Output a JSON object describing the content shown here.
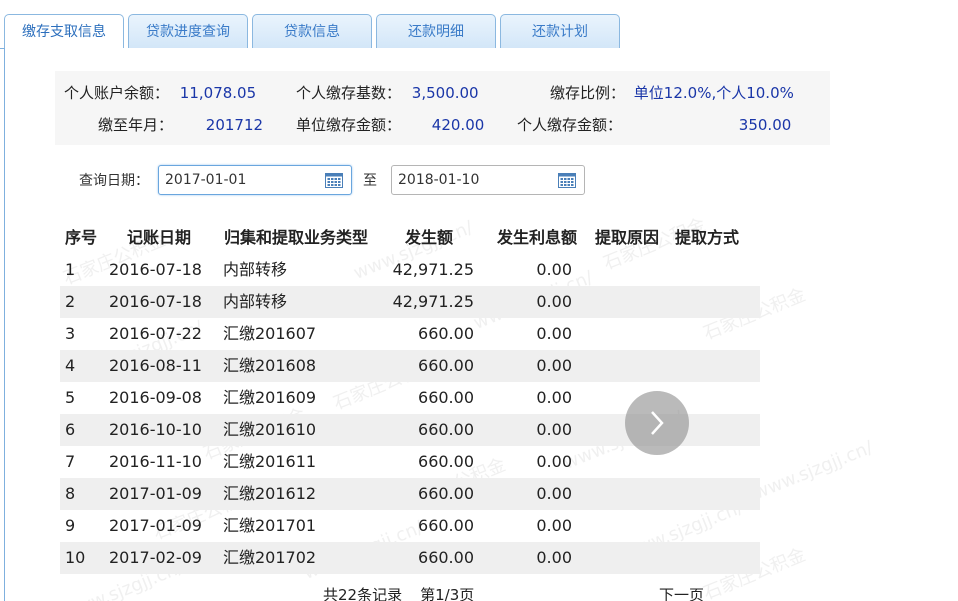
{
  "tabs": [
    {
      "label": "缴存支取信息",
      "active": true
    },
    {
      "label": "贷款进度查询",
      "active": false
    },
    {
      "label": "贷款信息",
      "active": false
    },
    {
      "label": "还款明细",
      "active": false
    },
    {
      "label": "还款计划",
      "active": false
    }
  ],
  "account": {
    "balance_label": "个人账户余额：",
    "balance": "11,078.05",
    "base_label": "个人缴存基数：",
    "base": "3,500.00",
    "ratio_label": "缴存比例：",
    "ratio": "单位12.0%,个人10.0%",
    "paid_until_label": "缴至年月：",
    "paid_until": "201712",
    "unit_amount_label": "单位缴存金额：",
    "unit_amount": "420.00",
    "personal_amount_label": "个人缴存金额：",
    "personal_amount": "350.00"
  },
  "query": {
    "label": "查询日期：",
    "start_date": "2017-01-01",
    "to_label": "至",
    "end_date": "2018-01-10"
  },
  "table": {
    "headers": [
      "序号",
      "记账日期",
      "归集和提取业务类型",
      "发生额",
      "发生利息额",
      "提取原因",
      "提取方式"
    ],
    "rows": [
      [
        "1",
        "2016-07-18",
        "内部转移",
        "42,971.25",
        "0.00",
        "",
        ""
      ],
      [
        "2",
        "2016-07-18",
        "内部转移",
        "42,971.25",
        "0.00",
        "",
        ""
      ],
      [
        "3",
        "2016-07-22",
        "汇缴201607",
        "660.00",
        "0.00",
        "",
        ""
      ],
      [
        "4",
        "2016-08-11",
        "汇缴201608",
        "660.00",
        "0.00",
        "",
        ""
      ],
      [
        "5",
        "2016-09-08",
        "汇缴201609",
        "660.00",
        "0.00",
        "",
        ""
      ],
      [
        "6",
        "2016-10-10",
        "汇缴201610",
        "660.00",
        "0.00",
        "",
        ""
      ],
      [
        "7",
        "2016-11-10",
        "汇缴201611",
        "660.00",
        "0.00",
        "",
        ""
      ],
      [
        "8",
        "2017-01-09",
        "汇缴201612",
        "660.00",
        "0.00",
        "",
        ""
      ],
      [
        "9",
        "2017-01-09",
        "汇缴201701",
        "660.00",
        "0.00",
        "",
        ""
      ],
      [
        "10",
        "2017-02-09",
        "汇缴201702",
        "660.00",
        "0.00",
        "",
        ""
      ]
    ]
  },
  "pager": {
    "total": "共22条记录",
    "page": "第1/3页",
    "next": "下一页"
  },
  "watermark": {
    "text": "石家庄公积金",
    "url": "www.sjzgjj.cn/"
  },
  "colors": {
    "tab_text": "#3a7bc8",
    "value_text": "#1a36a8",
    "border": "#7fb0de"
  }
}
